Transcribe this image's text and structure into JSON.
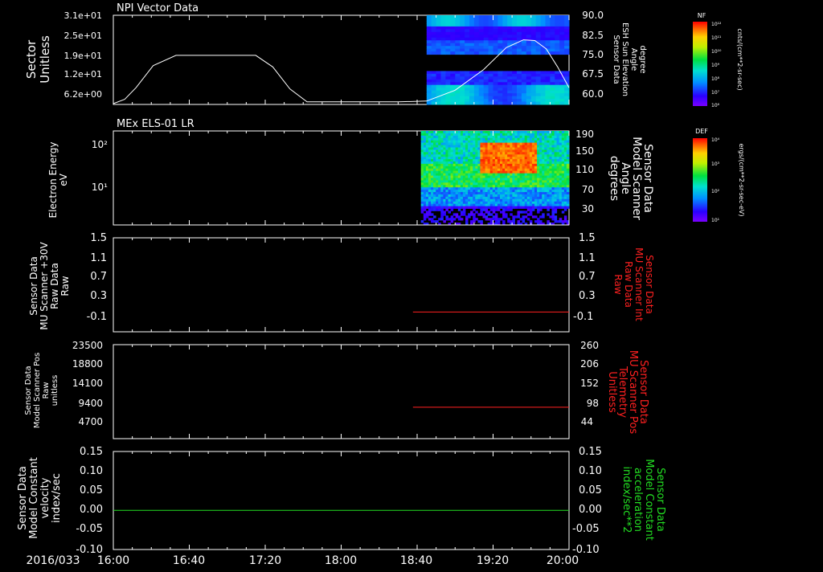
{
  "time_axis": {
    "date": "2016/033",
    "ticks": [
      "16:00",
      "16:40",
      "17:20",
      "18:00",
      "18:40",
      "19:20",
      "20:00"
    ],
    "range_hours": [
      16.0,
      20.0
    ]
  },
  "colors": {
    "white": "#ffffff",
    "red": "#ff2020",
    "green": "#22dd22",
    "background": "#000000"
  },
  "chart_data": [
    {
      "type": "heatmap",
      "title": "NPI Vector Data",
      "ylabel": [
        "Sector",
        "Unitless"
      ],
      "yticks": [
        "3.1e+01",
        "2.5e+01",
        "1.9e+01",
        "1.2e+01",
        "6.2e+00"
      ],
      "right_ylabel": [
        "Sensor Data",
        "ESH Sun Elevation",
        "Angle",
        "degree"
      ],
      "right_yticks": [
        "90.0",
        "82.5",
        "75.0",
        "67.5",
        "60.0"
      ],
      "right_ylim": [
        55.5,
        90.0
      ],
      "heatmap_x_start": 18.75,
      "overlay_series": {
        "name": "ESH Sun Elevation Angle",
        "x": [
          16.0,
          16.1,
          16.2,
          16.35,
          16.55,
          17.25,
          17.4,
          17.55,
          17.7,
          18.5,
          18.75,
          19.0,
          19.25,
          19.45,
          19.6,
          19.7,
          19.8,
          19.9,
          20.0
        ],
        "y": [
          55.8,
          57.5,
          62.0,
          70.5,
          74.5,
          74.5,
          70.0,
          61.5,
          56.5,
          56.5,
          56.8,
          61.0,
          69.0,
          77.5,
          80.5,
          80.2,
          77.0,
          70.0,
          62.0
        ]
      },
      "colorbar": {
        "label": "NF",
        "ticks": [
          "10¹²",
          "10¹¹",
          "10¹⁰",
          "10⁹",
          "10⁸",
          "10⁷",
          "10⁶"
        ],
        "unit": "cnts/(cm**2-sr-sec)"
      }
    },
    {
      "type": "heatmap",
      "title": "MEx ELS-01 LR",
      "ylabel": [
        "Electron Energy",
        "eV"
      ],
      "ylim_log": [
        0.0,
        2.15
      ],
      "yticks": [
        {
          "label": "10²",
          "value": 2
        },
        {
          "label": "10¹",
          "value": 1
        }
      ],
      "right_ylabel": [
        "Sensor Data",
        "Model Scanner",
        "Angle",
        "degrees"
      ],
      "right_yticks": [
        "190",
        "150",
        "110",
        "70",
        "30"
      ],
      "right_ylim": [
        9,
        190
      ],
      "heatmap_x_start": 18.7,
      "overlay_series": {
        "name": "Model Scanner Angle",
        "x": [
          16.0,
          20.0
        ],
        "y": [
          9,
          9
        ]
      },
      "colorbar": {
        "label": "DEF",
        "ticks": [
          "10⁴",
          "10³",
          "10²",
          "10¹"
        ],
        "unit": "ergs/(cm**2-sr-sec-eV)"
      }
    },
    {
      "type": "line",
      "ylabel": [
        "Sensor Data",
        "MU Scanner +30V",
        "Raw Data",
        "Raw"
      ],
      "yticks": [
        "1.5",
        "1.1",
        "0.7",
        "0.3",
        "-0.1"
      ],
      "ylim": [
        -0.4,
        1.5
      ],
      "right_ylabel": [
        "Sensor Data",
        "MU Scanner Int",
        "Raw Data",
        "Raw"
      ],
      "right_yticks": [
        "1.5",
        "1.1",
        "0.7",
        "0.3",
        "-0.1"
      ],
      "series": [
        {
          "name": "MU Scanner Int Raw Data",
          "x": [
            18.63,
            20.0
          ],
          "y": [
            0.0,
            0.0
          ],
          "color": "#ff2020"
        }
      ]
    },
    {
      "type": "line",
      "ylabel": [
        "Sensor Data",
        "Model Scanner Pos",
        "Raw",
        "unitless"
      ],
      "yticks": [
        "23500",
        "18800",
        "14100",
        "9400",
        "4700"
      ],
      "right_ylabel": [
        "Sensor Data",
        "MU Scanner Pos",
        "Telemetry",
        "Unitless"
      ],
      "right_yticks": [
        "260",
        "206",
        "152",
        "98",
        "44"
      ],
      "right_ylim": [
        0,
        260
      ],
      "series": [
        {
          "name": "MU Scanner Pos Telemetry",
          "x": [
            18.63,
            20.0
          ],
          "y": [
            87,
            87
          ],
          "color": "#ff2020"
        }
      ]
    },
    {
      "type": "line",
      "ylabel": [
        "Sensor Data",
        "Model Constant",
        "velocity",
        "index/sec"
      ],
      "yticks": [
        "0.15",
        "0.10",
        "0.05",
        "0.00",
        "-0.05",
        "-0.10"
      ],
      "ylim": [
        -0.1,
        0.15
      ],
      "right_ylabel": [
        "Sensor Data",
        "Model Constant",
        "acceleration",
        "index/sec**2"
      ],
      "right_yticks": [
        "0.15",
        "0.10",
        "0.05",
        "0.00",
        "-0.05",
        "-0.10"
      ],
      "series": [
        {
          "name": "Model Constant acceleration",
          "x": [
            16.0,
            20.0
          ],
          "y": [
            0.0,
            0.0
          ],
          "color": "#22dd22"
        }
      ]
    }
  ]
}
